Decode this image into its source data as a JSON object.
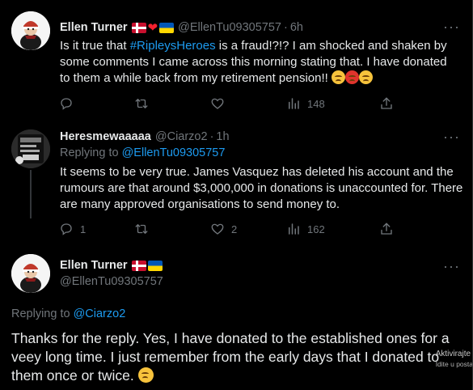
{
  "tweets": [
    {
      "name": "Ellen Turner",
      "handle": "@EllenTu09305757",
      "time": "6h",
      "text_pre": "Is it true that ",
      "hashtag": "#RipleysHeroes",
      "text_post": " is a fraud!?!? I am shocked and shaken by some comments I came across this morning stating that. I have donated to them a while back from my retirement pension!!",
      "actions": {
        "replies": "",
        "retweets": "",
        "likes": "",
        "views": "148"
      }
    },
    {
      "name": "Heresmewaaaaa",
      "handle": "@Ciarzo2",
      "time": "1h",
      "replying_label": "Replying to",
      "replying_to": "@EllenTu09305757",
      "text": "It seems to be very true. James Vasquez has deleted his account and the rumours are that around $3,000,000 in donations is unaccounted for. There are many approved organisations to send money to.",
      "actions": {
        "replies": "1",
        "retweets": "",
        "likes": "2",
        "views": "162"
      }
    },
    {
      "name": "Ellen Turner",
      "handle": "@EllenTu09305757",
      "replying_label": "Replying to",
      "replying_to": "@Ciarzo2",
      "text": "Thanks for the reply. Yes, I have donated to the established ones for a veey long time. I just remember from the early days that I donated to them once or twice."
    }
  ],
  "watermark": {
    "line1": "Aktivirajte",
    "line2": "Idite u posta"
  },
  "icons": [
    "reply-icon",
    "retweet-icon",
    "like-icon",
    "views-icon",
    "share-icon",
    "more-icon",
    "heart-emoji",
    "denmark-flag",
    "ukraine-flag"
  ],
  "colors": {
    "background": "#000000",
    "text": "#e7e9ea",
    "muted": "#71767b",
    "link": "#1d9bf0",
    "heart": "#f4212e"
  }
}
